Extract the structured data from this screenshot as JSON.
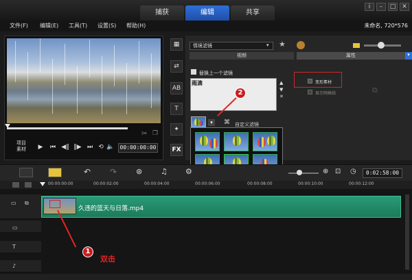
{
  "tabs": [
    {
      "label": "捕获",
      "active": false
    },
    {
      "label": "编辑",
      "active": true
    },
    {
      "label": "共享",
      "active": false
    }
  ],
  "menu": [
    "文件(F)",
    "编辑(E)",
    "工具(T)",
    "设置(S)",
    "帮助(H)"
  ],
  "project_info": "未命名, 720*576",
  "preview": {
    "mode_label_1": "项目",
    "mode_label_2": "素材",
    "timecode": "00:00:00:00"
  },
  "filter_panel": {
    "library_select": "情境滤镜",
    "tab_video": "视频",
    "tab_properties": "属性",
    "replace_last_filter_label": "替换上一个滤镜",
    "applied_filter": "雨滴",
    "custom_filter_label": "自定义滤镜",
    "transform_clip_label": "变形素材",
    "show_grid_label": "显示网格线"
  },
  "timeline": {
    "timecode": "0:02:58:00",
    "ruler": [
      "00:00:00:00",
      "00:00:02:00",
      "00:00:04:00",
      "00:00:06:00",
      "00:00:08:00",
      "00:00:10:00",
      "00:00:12:00"
    ],
    "clip_name": "久违的蓝天与日落.mp4"
  },
  "annotations": {
    "step1": "1",
    "step2": "2",
    "double_click": "双击"
  },
  "colors": {
    "accent_blue": "#2f6fd8",
    "clip_green": "#2a9a76",
    "annotation_red": "#d32626"
  }
}
